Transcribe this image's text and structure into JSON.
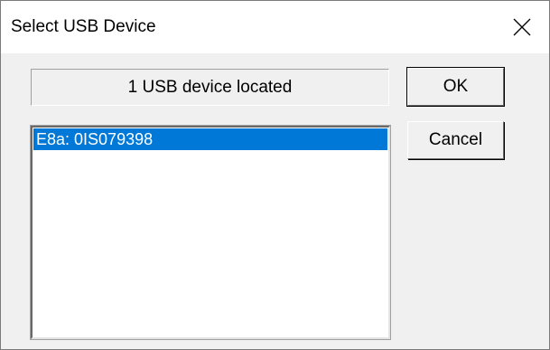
{
  "window": {
    "title": "Select USB Device",
    "close_icon": "close-icon"
  },
  "status": {
    "text": "1 USB device located"
  },
  "device_list": {
    "items": [
      {
        "label": "E8a: 0IS079398",
        "selected": true
      }
    ]
  },
  "buttons": {
    "ok_label": "OK",
    "cancel_label": "Cancel"
  },
  "colors": {
    "selection": "#0078d7",
    "dialog_bg": "#f0f0f0",
    "titlebar_bg": "#ffffff"
  }
}
